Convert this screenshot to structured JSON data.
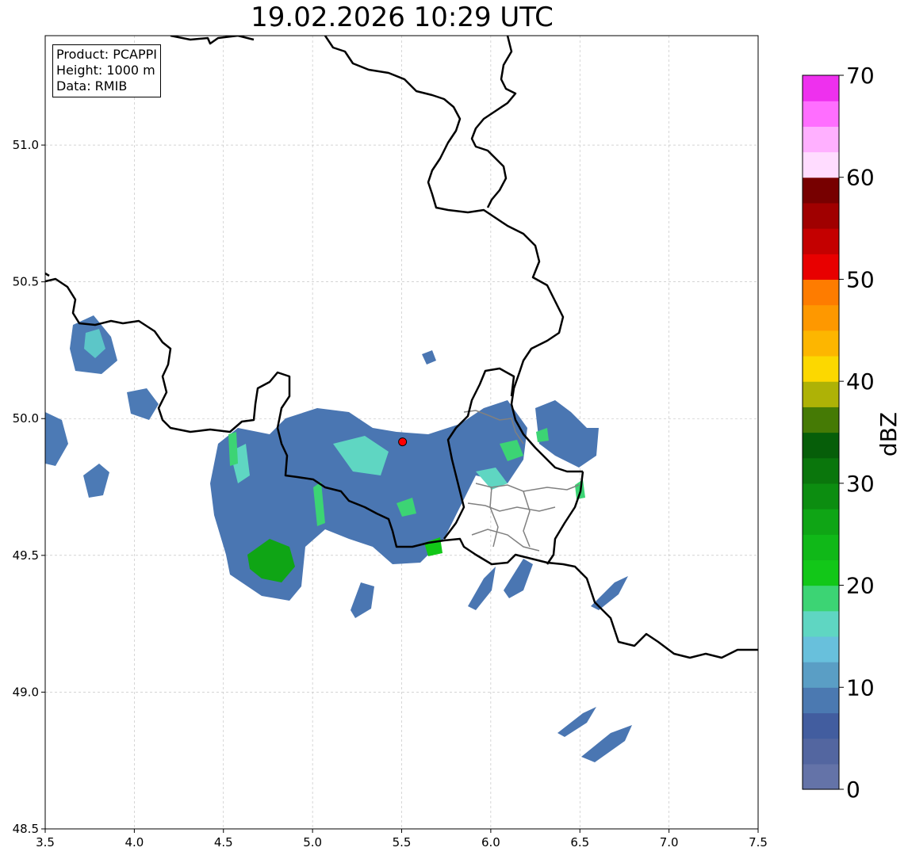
{
  "title": "19.02.2026 10:29 UTC",
  "info_box": {
    "product_line": "Product: PCAPPI",
    "height_line": "Height: 1000 m",
    "data_line": "Data: RMIB"
  },
  "map": {
    "lon_range": [
      3.5,
      7.5
    ],
    "lat_range": [
      48.5,
      51.4
    ],
    "x_ticks": [
      "3.5",
      "4.0",
      "4.5",
      "5.0",
      "5.5",
      "6.0",
      "6.5",
      "7.0",
      "7.5"
    ],
    "y_ticks": [
      "48.5",
      "49.0",
      "49.5",
      "50.0",
      "50.5",
      "51.0"
    ],
    "grid": true,
    "radar_site": {
      "lon": 5.505,
      "lat": 49.915,
      "color": "#ff0000"
    },
    "border_color": "#000000",
    "subregion_border_color": "#808080"
  },
  "colorbar": {
    "label": "dBZ",
    "min": 0,
    "max": 70,
    "tick_labels": [
      "0",
      "10",
      "20",
      "30",
      "40",
      "50",
      "60",
      "70"
    ],
    "colors": [
      "#6473a8",
      "#5366a0",
      "#425d9f",
      "#4b79b1",
      "#5a9ec5",
      "#68c0dc",
      "#5fd6c2",
      "#3cd474",
      "#12c718",
      "#10b818",
      "#0fa515",
      "#0c8d10",
      "#0a760c",
      "#065e09",
      "#457a05",
      "#aeb206",
      "#fcd800",
      "#fdb600",
      "#fe9800",
      "#fe7c00",
      "#e80000",
      "#c40000",
      "#a00000",
      "#770000",
      "#ffdcff",
      "#ffb0ff",
      "#ff6eff",
      "#ee30ee"
    ]
  }
}
